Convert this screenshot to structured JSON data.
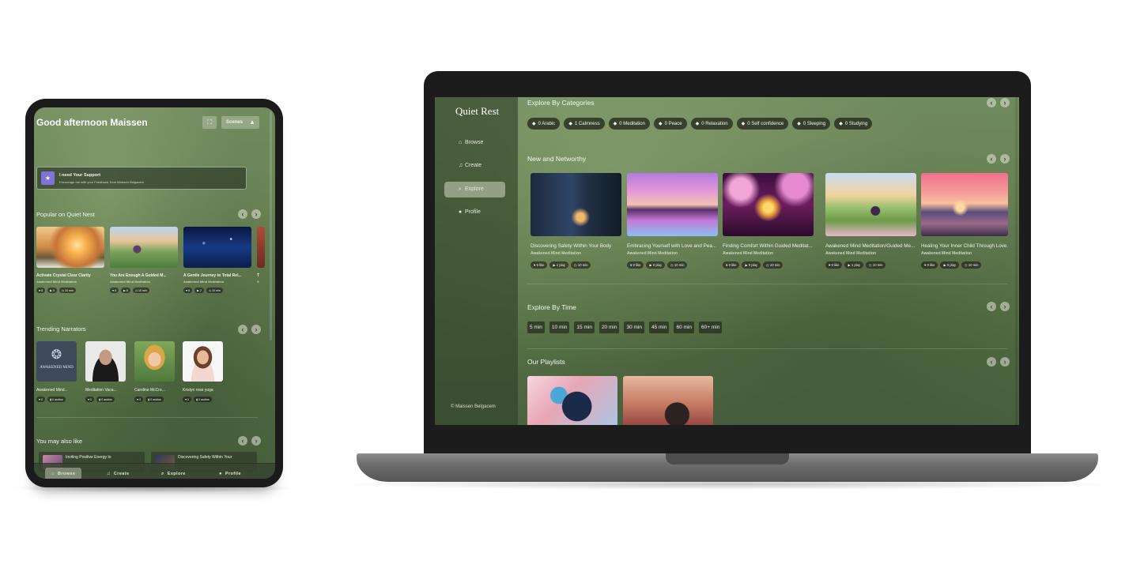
{
  "tablet": {
    "greeting": "Good afternoon Maissen",
    "expand_icon": "expand-icon",
    "scenes_label": "Scenes",
    "support": {
      "title": "I need Your Support",
      "subtitle": "Encourage me with your Feedback, from Maissen Belgacem"
    },
    "popular": {
      "title": "Popular on Quiet Nest",
      "cards": [
        {
          "title": "Activate Crystal Clear Clarity",
          "narrator": "Awakened Mind Meditation",
          "likes": "8",
          "plays": "9",
          "duration": "10 min"
        },
        {
          "title": "You Are Enough A Guided M...",
          "narrator": "Awakened Mind Meditation",
          "likes": "8",
          "plays": "8",
          "duration": "10 min"
        },
        {
          "title": "A Gentle Journey to Total Rel...",
          "narrator": "Awakened Mind Meditation",
          "likes": "8",
          "plays": "2",
          "duration": "10 min"
        },
        {
          "title": "T",
          "narrator": "S",
          "likes": "",
          "plays": "",
          "duration": ""
        }
      ]
    },
    "narrators": {
      "title": "Trending Narrators",
      "items": [
        {
          "name": "Awakened Mind...",
          "likes": "0",
          "audios": "0 audios",
          "logo_text": "AWAKENED MIND"
        },
        {
          "name": "Meditation Vaca...",
          "likes": "0",
          "audios": "0 audios"
        },
        {
          "name": "Caroline McCre...",
          "likes": "0",
          "audios": "0 audios"
        },
        {
          "name": "Kristyn rose yoga",
          "likes": "0",
          "audios": "0 audios"
        }
      ]
    },
    "also": {
      "title": "You may also like",
      "items": [
        {
          "title": "Inviting Positive Energy to"
        },
        {
          "title": "Discovering Safety Within Your"
        }
      ]
    },
    "nav": [
      {
        "label": "Browse",
        "icon": "home-icon",
        "glyph": "⌂"
      },
      {
        "label": "Create",
        "icon": "music-icon",
        "glyph": "♫"
      },
      {
        "label": "Explore",
        "icon": "search-icon",
        "glyph": "⌕"
      },
      {
        "label": "Profile",
        "icon": "user-icon",
        "glyph": "●"
      }
    ]
  },
  "laptop": {
    "logo": "Quiet Rest",
    "nav": [
      {
        "label": "Browse",
        "icon": "home-icon",
        "glyph": "⌂"
      },
      {
        "label": "Create",
        "icon": "music-icon",
        "glyph": "♫"
      },
      {
        "label": "Explore",
        "icon": "search-icon",
        "glyph": "⌕"
      },
      {
        "label": "Profile",
        "icon": "user-icon",
        "glyph": "●"
      }
    ],
    "copyright": "© Maissen Belgacem",
    "categories": {
      "title": "Explore By Categories",
      "items": [
        "0 Arabic",
        "1 Calmness",
        "0 Meditation",
        "0 Peace",
        "0 Relaxation",
        "0 Self confidence",
        "0 Sleeping",
        "0 Studying"
      ]
    },
    "new": {
      "title": "New and Networthy",
      "cards": [
        {
          "title": "Discovering Safety Within Your Body",
          "narrator": "Awakened Mind Meditation",
          "likes": "0 like",
          "plays": "1 play",
          "duration": "10 min"
        },
        {
          "title": "Embracing Yourself with Love and Pea...",
          "narrator": "Awakened Mind Meditation",
          "likes": "0 like",
          "plays": "0 play",
          "duration": "10 min"
        },
        {
          "title": "Finding Comfort Within Guided Meditat...",
          "narrator": "Awakened Mind Meditation",
          "likes": "0 like",
          "plays": "0 play",
          "duration": "10 min"
        },
        {
          "title": "Awakened Mind Meditation/Guided Me...",
          "narrator": "Awakened Mind Meditation",
          "likes": "0 like",
          "plays": "1 play",
          "duration": "10 min"
        },
        {
          "title": "Healing Your Inner Child Through Love...",
          "narrator": "Awakened Mind Meditation",
          "likes": "0 like",
          "plays": "0 play",
          "duration": "10 min"
        }
      ]
    },
    "time": {
      "title": "Explore By Time",
      "items": [
        "5 min",
        "10 min",
        "15 min",
        "20 min",
        "30 min",
        "45 min",
        "60 min",
        "60+ min"
      ]
    },
    "playlists": {
      "title": "Our Playlists"
    }
  },
  "icons": {
    "heart": "heart-icon",
    "play": "play-icon",
    "clock": "clock-icon",
    "mic": "mic-icon",
    "tag": "tag-icon",
    "arrow_left": "chevron-left-icon",
    "arrow_right": "chevron-right-icon"
  }
}
